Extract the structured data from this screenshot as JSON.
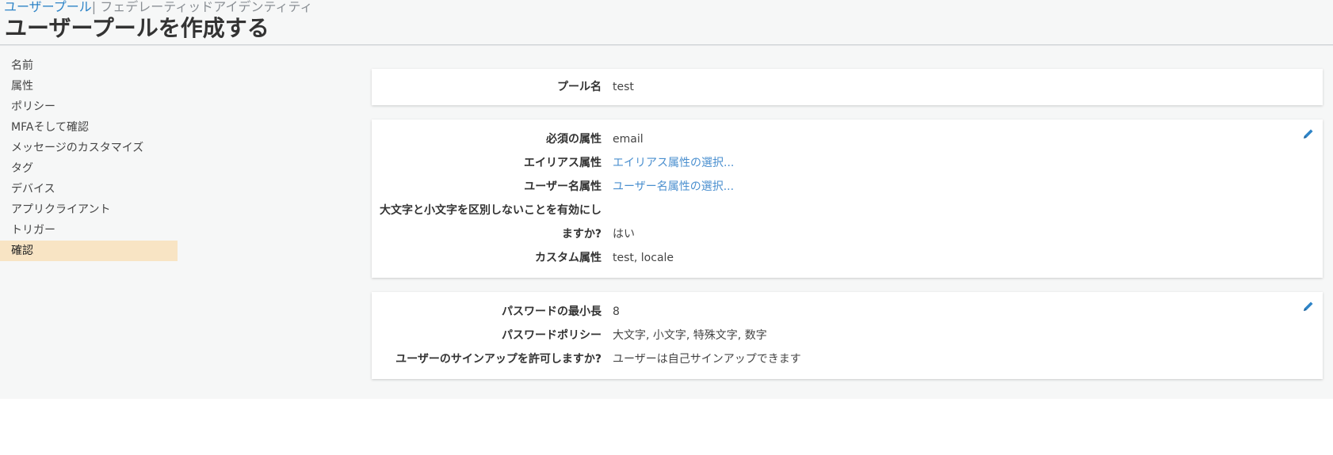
{
  "breadcrumb": {
    "link": "ユーザープール",
    "separator": "|",
    "rest": "フェデレーティッドアイデンティティ"
  },
  "page_title": "ユーザープールを作成する",
  "sidebar": {
    "items": [
      {
        "label": "名前"
      },
      {
        "label": "属性"
      },
      {
        "label": "ポリシー"
      },
      {
        "label": "MFAそして確認"
      },
      {
        "label": "メッセージのカスタマイズ"
      },
      {
        "label": "タグ"
      },
      {
        "label": "デバイス"
      },
      {
        "label": "アプリクライアント"
      },
      {
        "label": "トリガー"
      },
      {
        "label": "確認",
        "active": true
      }
    ]
  },
  "pool_card": {
    "label": "プール名",
    "value": "test"
  },
  "attributes_card": {
    "required_label": "必須の属性",
    "required_value": "email",
    "alias_label": "エイリアス属性",
    "alias_value": "エイリアス属性の選択...",
    "username_label": "ユーザー名属性",
    "username_value": "ユーザー名属性の選択...",
    "case_label_line1": "大文字と小文字を区別しないことを有効にし",
    "case_label_line2": "ますか?",
    "case_value": "はい",
    "custom_label": "カスタム属性",
    "custom_value": "test, locale"
  },
  "policy_card": {
    "min_length_label": "パスワードの最小長",
    "min_length_value": "8",
    "password_policy_label": "パスワードポリシー",
    "password_policy_value": "大文字, 小文字, 特殊文字, 数字",
    "signup_label": "ユーザーのサインアップを許可しますか?",
    "signup_value": "ユーザーは自己サインアップできます"
  },
  "colors": {
    "link": "#2e84c7",
    "active_nav": "#f8e4c4",
    "background": "#f6f7f7",
    "edit_icon": "#2e84c7"
  },
  "icons": {
    "edit": "pencil-icon"
  }
}
